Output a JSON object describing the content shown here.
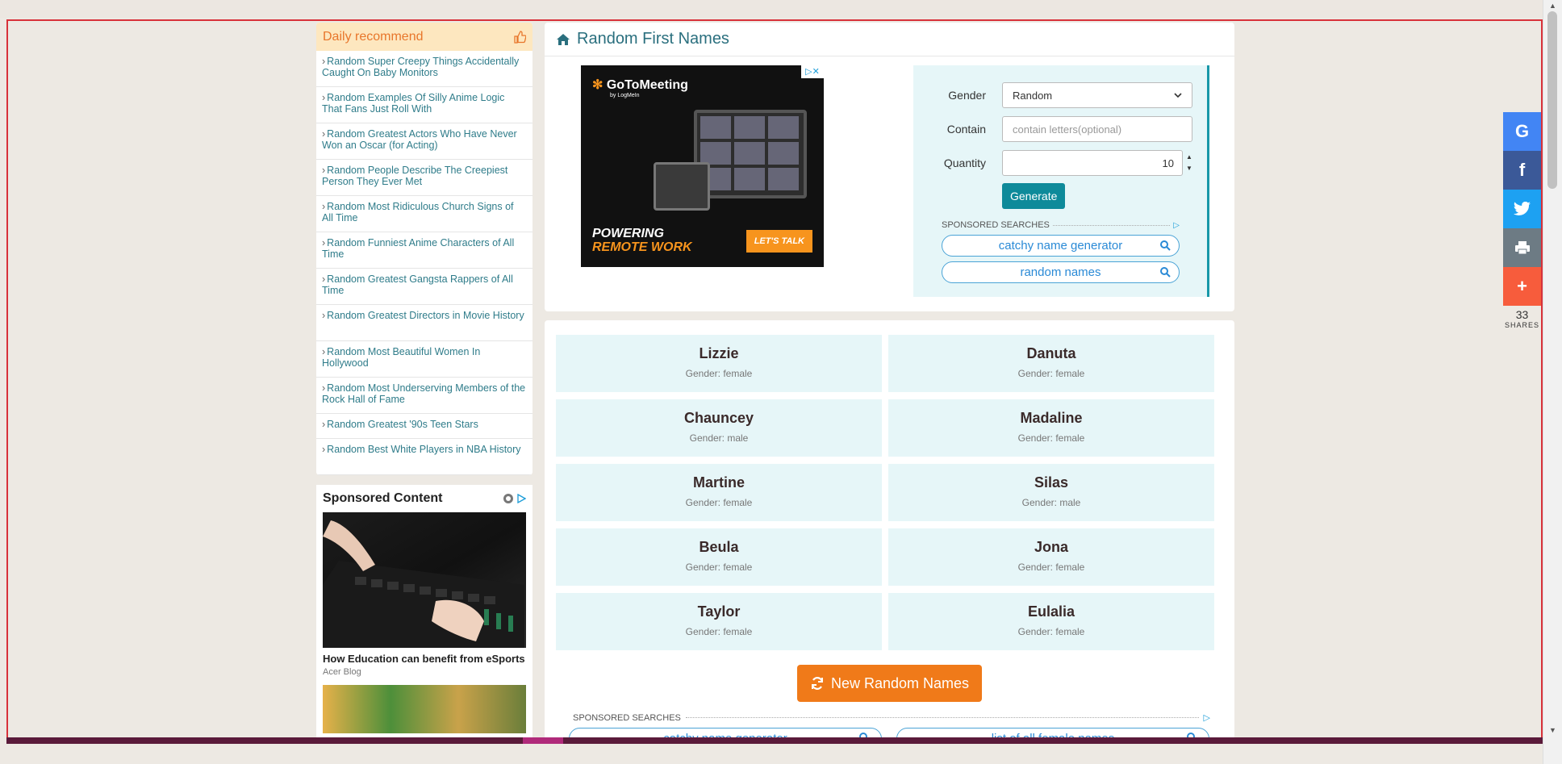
{
  "sidebar": {
    "daily_title": "Daily recommend",
    "items": [
      "Random Super Creepy Things Accidentally Caught On Baby Monitors",
      "Random Examples Of Silly Anime Logic That Fans Just Roll With",
      "Random Greatest Actors Who Have Never Won an Oscar (for Acting)",
      "Random People Describe The Creepiest Person They Ever Met",
      "Random Most Ridiculous Church Signs of All Time",
      "Random Funniest Anime Characters of All Time",
      "Random Greatest Gangsta Rappers of All Time",
      "Random Greatest Directors in Movie History",
      "Random Most Beautiful Women In Hollywood",
      "Random Most Underserving Members of the Rock Hall of Fame",
      "Random Greatest '90s Teen Stars",
      "Random Best White Players in NBA History"
    ],
    "sponsored_title": "Sponsored Content",
    "sponsored_caption": "How Education can benefit from eSports",
    "sponsored_source": "Acer Blog"
  },
  "header": {
    "title": "Random First Names"
  },
  "ad": {
    "brand": "GoToMeeting",
    "brand_sub": "by LogMeIn",
    "headline_1": "POWERING",
    "headline_2": "REMOTE WORK",
    "cta": "LET'S TALK"
  },
  "form": {
    "gender_label": "Gender",
    "gender_value": "Random",
    "contain_label": "Contain",
    "contain_placeholder": "contain letters(optional)",
    "quantity_label": "Quantity",
    "quantity_value": "10",
    "generate_label": "Generate",
    "sponsored_label": "SPONSORED SEARCHES",
    "searches": [
      "catchy name generator",
      "random names"
    ]
  },
  "names": [
    {
      "name": "Lizzie",
      "gender": "Gender: female"
    },
    {
      "name": "Danuta",
      "gender": "Gender: female"
    },
    {
      "name": "Chauncey",
      "gender": "Gender: male"
    },
    {
      "name": "Madaline",
      "gender": "Gender: female"
    },
    {
      "name": "Martine",
      "gender": "Gender: female"
    },
    {
      "name": "Silas",
      "gender": "Gender: male"
    },
    {
      "name": "Beula",
      "gender": "Gender: female"
    },
    {
      "name": "Jona",
      "gender": "Gender: female"
    },
    {
      "name": "Taylor",
      "gender": "Gender: female"
    },
    {
      "name": "Eulalia",
      "gender": "Gender: female"
    }
  ],
  "new_names_label": "New Random Names",
  "bottom_sponsored": {
    "label": "SPONSORED SEARCHES",
    "searches": [
      "catchy name generator",
      "list of all female names"
    ]
  },
  "share": {
    "count": "33",
    "label": "SHARES",
    "colors": {
      "google": "#4285f4",
      "facebook": "#3b5998",
      "twitter": "#1da1f2",
      "print": "#6d7b84",
      "more": "#f75c3c"
    }
  },
  "colors": {
    "accent": "#2a6f7e",
    "orange": "#f07a19",
    "teal_button": "#0e8a9a",
    "card_bg": "#e6f6f8"
  }
}
